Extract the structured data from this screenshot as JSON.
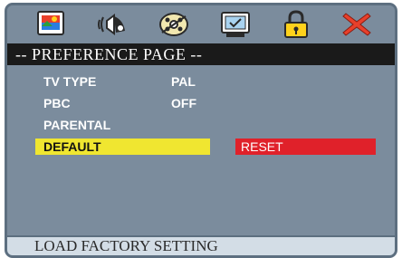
{
  "icons": [
    {
      "name": "general-setup-icon"
    },
    {
      "name": "audio-setup-icon"
    },
    {
      "name": "dolby-setup-icon"
    },
    {
      "name": "video-setup-icon"
    },
    {
      "name": "preference-lock-icon"
    },
    {
      "name": "exit-icon"
    }
  ],
  "page": {
    "title": "-- PREFERENCE PAGE --",
    "items": [
      {
        "label": "TV TYPE",
        "value": "PAL"
      },
      {
        "label": "PBC",
        "value": "OFF"
      },
      {
        "label": "PARENTAL",
        "value": ""
      },
      {
        "label": "DEFAULT",
        "value": "",
        "selected": true
      }
    ],
    "option": "RESET"
  },
  "status": {
    "text": "LOAD FACTORY SETTING"
  },
  "colors": {
    "panel": "#7b8c9d",
    "title_bg": "#1a1a1a",
    "highlight": "#f0e630",
    "option_bg": "#e0212a",
    "status_bg": "#d3dde6"
  }
}
